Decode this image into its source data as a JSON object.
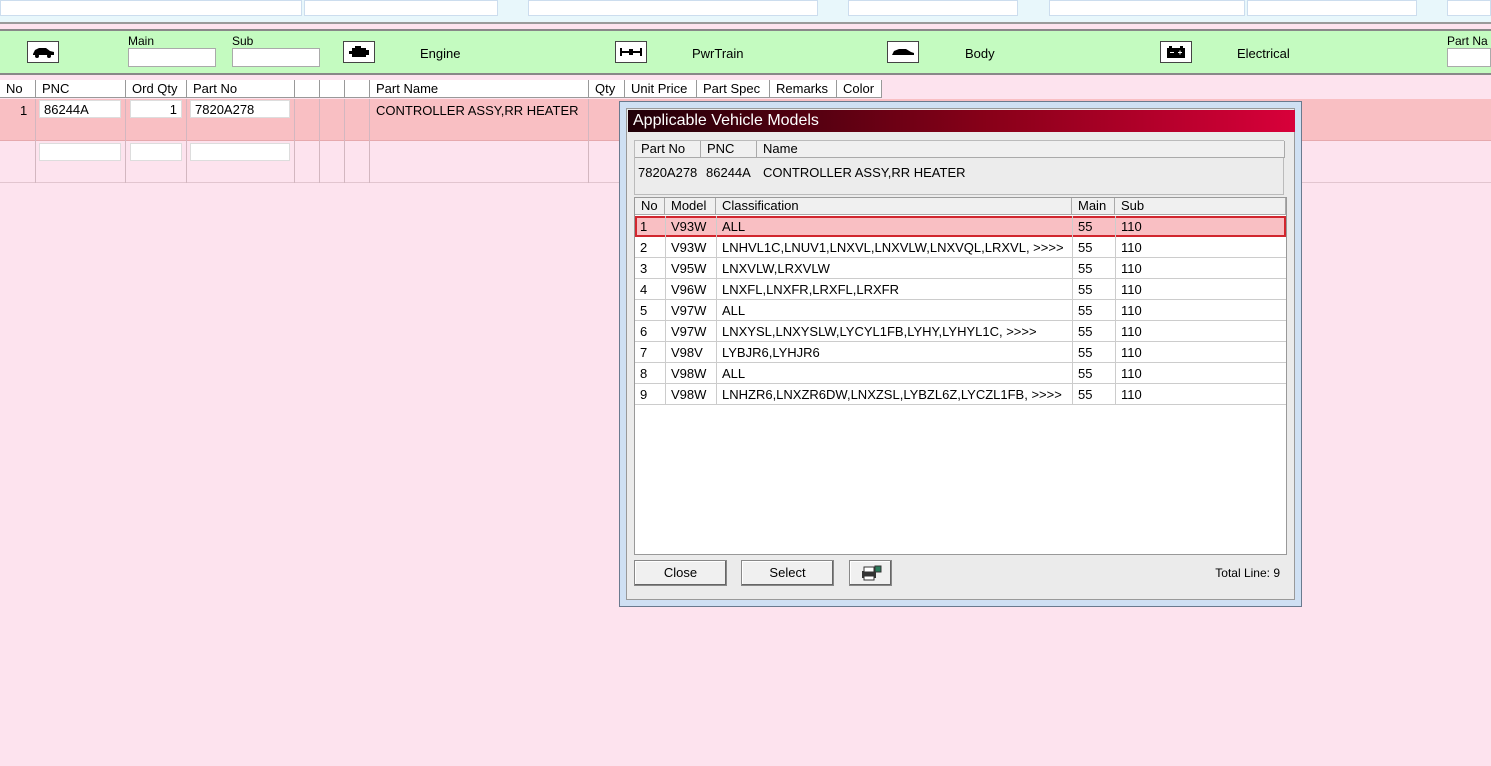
{
  "category_bar": {
    "main_label": "Main",
    "sub_label": "Sub",
    "engine_label": "Engine",
    "pwrtrain_label": "PwrTrain",
    "body_label": "Body",
    "electrical_label": "Electrical",
    "part_name_label": "Part Na"
  },
  "grid": {
    "headers": {
      "no": "No",
      "pnc": "PNC",
      "ord_qty": "Ord Qty",
      "part_no": "Part No",
      "part_name": "Part Name",
      "qty": "Qty",
      "unit_price": "Unit Price",
      "part_spec": "Part Spec",
      "remarks": "Remarks",
      "color": "Color"
    },
    "rows": [
      {
        "no": "1",
        "pnc": "86244A",
        "ord_qty": "1",
        "part_no": "7820A278",
        "part_name": "CONTROLLER ASSY,RR HEATER"
      }
    ]
  },
  "dialog": {
    "title": "Applicable Vehicle Models",
    "info_headers": {
      "part_no": "Part No",
      "pnc": "PNC",
      "name": "Name"
    },
    "info": {
      "part_no": "7820A278",
      "pnc": "86244A",
      "name": "CONTROLLER ASSY,RR HEATER"
    },
    "list_headers": {
      "no": "No",
      "model": "Model",
      "classification": "Classification",
      "main": "Main",
      "sub": "Sub"
    },
    "rows": [
      {
        "no": "1",
        "model": "V93W",
        "classification": "ALL",
        "main": "55",
        "sub": "110"
      },
      {
        "no": "2",
        "model": "V93W",
        "classification": "LNHVL1C,LNUV1,LNXVL,LNXVLW,LNXVQL,LRXVL,  >>>>",
        "main": "55",
        "sub": "110"
      },
      {
        "no": "3",
        "model": "V95W",
        "classification": "LNXVLW,LRXVLW",
        "main": "55",
        "sub": "110"
      },
      {
        "no": "4",
        "model": "V96W",
        "classification": "LNXFL,LNXFR,LRXFL,LRXFR",
        "main": "55",
        "sub": "110"
      },
      {
        "no": "5",
        "model": "V97W",
        "classification": "ALL",
        "main": "55",
        "sub": "110"
      },
      {
        "no": "6",
        "model": "V97W",
        "classification": "LNXYSL,LNXYSLW,LYCYL1FB,LYHY,LYHYL1C,  >>>>",
        "main": "55",
        "sub": "110"
      },
      {
        "no": "7",
        "model": "V98V",
        "classification": "LYBJR6,LYHJR6",
        "main": "55",
        "sub": "110"
      },
      {
        "no": "8",
        "model": "V98W",
        "classification": "ALL",
        "main": "55",
        "sub": "110"
      },
      {
        "no": "9",
        "model": "V98W",
        "classification": "LNHZR6,LNXZR6DW,LNXZSL,LYBZL6Z,LYCZL1FB,  >>>>",
        "main": "55",
        "sub": "110"
      }
    ],
    "close_label": "Close",
    "select_label": "Select",
    "total_line": "Total Line: 9",
    "selected_row": "1"
  },
  "icons": [
    "car-icon",
    "engine-icon",
    "powertrain-icon",
    "body-icon",
    "battery-icon",
    "printer-icon"
  ]
}
